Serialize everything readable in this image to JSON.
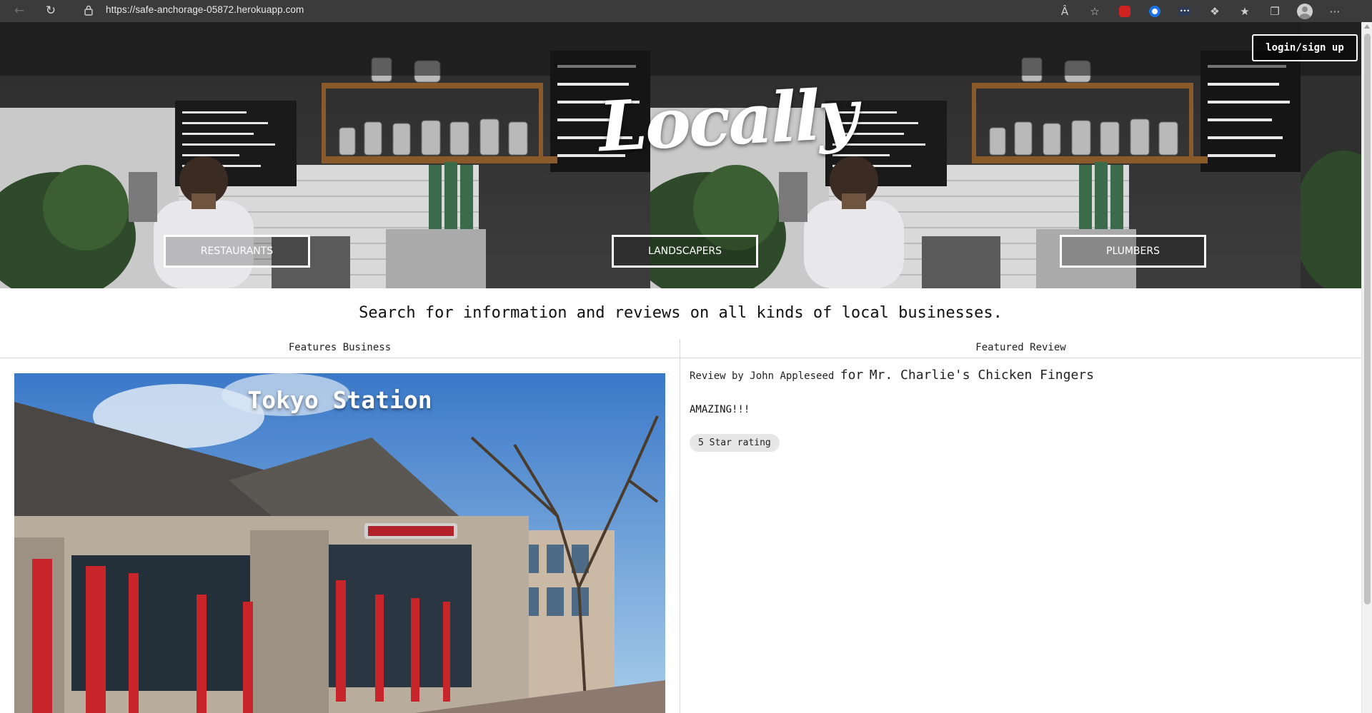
{
  "browser": {
    "url": "https://safe-anchorage-05872.herokuapp.com"
  },
  "hero": {
    "logo": "Locally",
    "login_label": "login/sign up",
    "categories": [
      "RESTAURANTS",
      "LANDSCAPERS",
      "PLUMBERS"
    ],
    "icons": [
      "back-icon",
      "reload-icon",
      "lock-icon"
    ]
  },
  "tagline": "Search for information and reviews on all kinds of local businesses.",
  "featured_business": {
    "heading": "Features Business",
    "name": "Tokyo Station"
  },
  "featured_review": {
    "heading": "Featured Review",
    "by_prefix": "Review by",
    "reviewer": "John Appleseed",
    "for_prefix": "for",
    "business": "Mr. Charlie's Chicken Fingers",
    "text": "AMAZING!!!",
    "rating": "5 Star rating"
  },
  "colors": {
    "chrome_bg": "#3b3b3b",
    "button_border": "#ffffff",
    "badge_bg": "#e6e6e6"
  }
}
